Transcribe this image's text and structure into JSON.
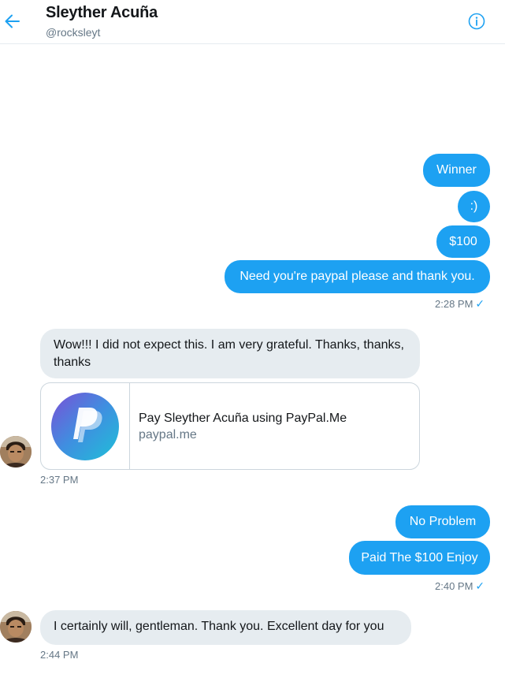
{
  "header": {
    "name": "Sleyther Acuña",
    "handle": "@rocksleyt"
  },
  "messages": {
    "out1": "Winner",
    "out2": ":)",
    "out3": "$100",
    "out4": "Need you're paypal please and thank you.",
    "time_out1": "2:28 PM",
    "in1": "Wow!!! I did not expect this.  I am very grateful. Thanks, thanks, thanks",
    "card_title": "Pay Sleyther Acuña using PayPal.Me",
    "card_domain": "paypal.me",
    "time_in1": "2:37 PM",
    "out5": "No Problem",
    "out6": "Paid The $100 Enjoy",
    "time_out2": "2:40 PM",
    "in2": "I certainly will, gentleman.  Thank you.  Excellent day for you",
    "time_in2": "2:44 PM",
    "check_glyph": "✓"
  },
  "icons": {
    "back": "arrow-left-icon",
    "info": "info-circle-icon",
    "paypal": "paypal-logo"
  },
  "colors": {
    "accent": "#1da1f2",
    "incoming_bubble": "#e6ecf0",
    "secondary_text": "#657786"
  }
}
